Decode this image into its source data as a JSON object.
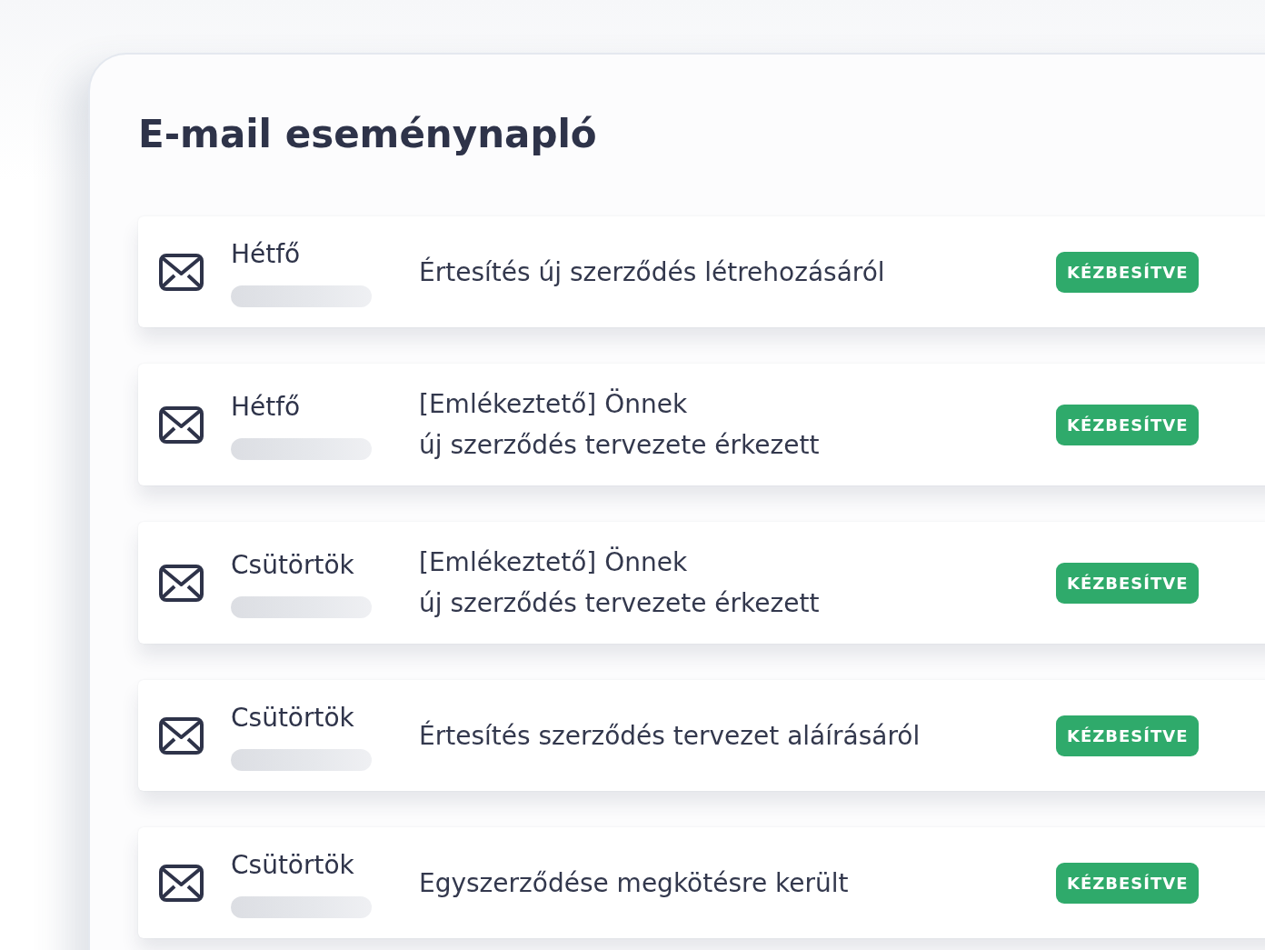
{
  "title": "E-mail eseménynapló",
  "events": [
    {
      "day": "Hétfő",
      "subject": "Értesítés új szerződés létrehozásáról",
      "status": "KÉZBESÍTVE"
    },
    {
      "day": "Hétfő",
      "subject": "[Emlékeztető] Önnek\núj szerződés tervezete érkezett",
      "status": "KÉZBESÍTVE"
    },
    {
      "day": "Csütörtök",
      "subject": "[Emlékeztető] Önnek\núj szerződés tervezete érkezett",
      "status": "KÉZBESÍTVE"
    },
    {
      "day": "Csütörtök",
      "subject": "Értesítés szerződés tervezet aláírásáról",
      "status": "KÉZBESÍTVE"
    },
    {
      "day": "Csütörtök",
      "subject": "Egyszerződése megkötésre került",
      "status": "KÉZBESÍTVE"
    }
  ]
}
